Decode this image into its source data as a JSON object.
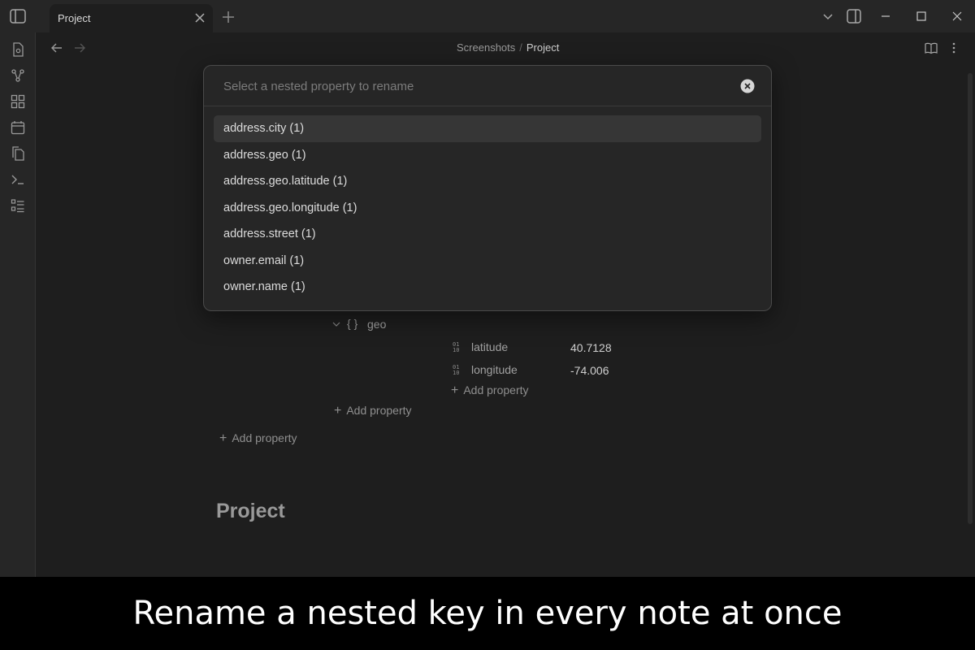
{
  "tab": {
    "label": "Project"
  },
  "breadcrumb": {
    "parent": "Screenshots",
    "separator": "/",
    "current": "Project"
  },
  "modal": {
    "placeholder": "Select a nested property to rename",
    "items": [
      "address.city (1)",
      "address.geo (1)",
      "address.geo.latitude (1)",
      "address.geo.longitude (1)",
      "address.street (1)",
      "owner.email (1)",
      "owner.name (1)"
    ],
    "selected_index": 0
  },
  "properties": {
    "geo_brace": "{ }",
    "geo_label": "geo",
    "latitude_label": "latitude",
    "latitude_value": "40.7128",
    "longitude_label": "longitude",
    "longitude_value": "-74.006",
    "add_geo": "Add property",
    "add_address": "Add property",
    "add_root": "Add property"
  },
  "note": {
    "title": "Project"
  },
  "caption": {
    "text": "Rename a nested key in every note at once"
  },
  "colors": {
    "background": "#1e1e1e",
    "chrome": "#262626",
    "caption_bg": "#000000"
  }
}
